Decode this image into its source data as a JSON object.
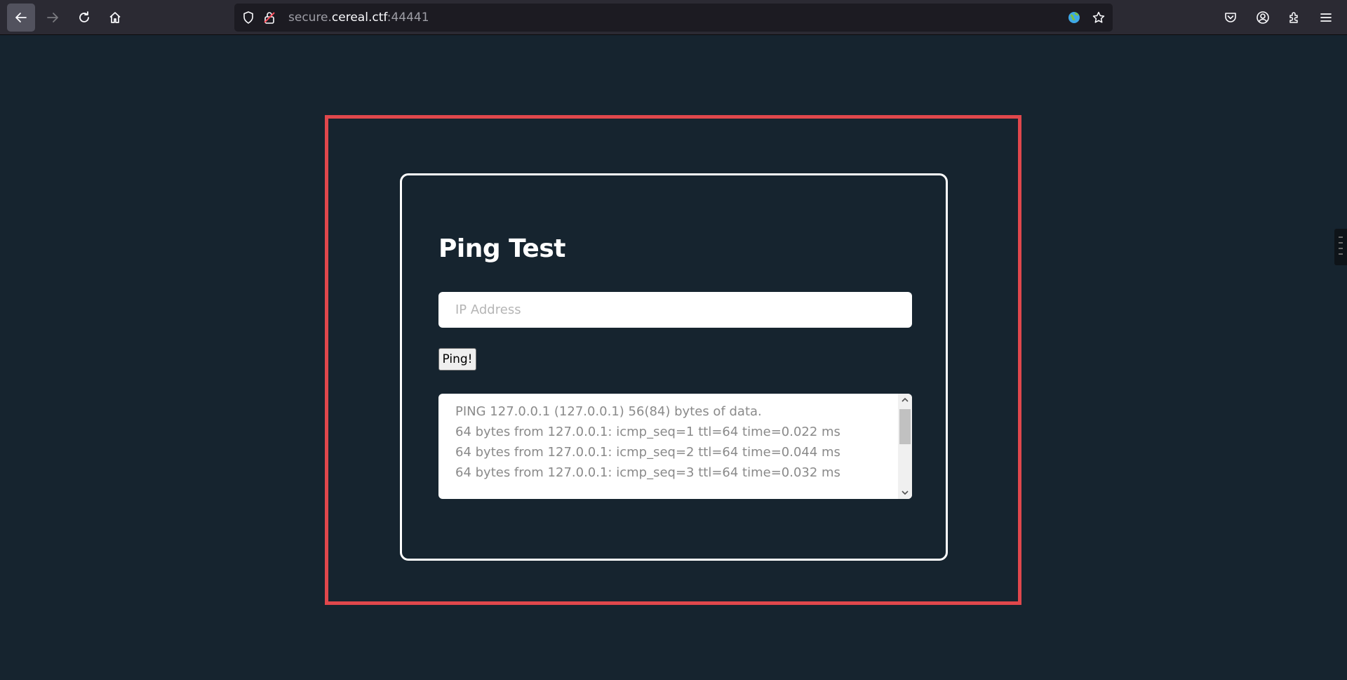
{
  "browser": {
    "url_prefix": "secure.",
    "url_host": "cereal.ctf",
    "url_suffix": ":44441",
    "toolbar_color": "#2b2a33",
    "icons": [
      "back-arrow-icon",
      "forward-arrow-icon",
      "reload-icon",
      "home-icon",
      "shield-icon",
      "insecure-lock-icon",
      "globe-icon",
      "star-icon",
      "pocket-icon",
      "account-icon",
      "extensions-icon",
      "menu-icon"
    ]
  },
  "page": {
    "background": "#16242f",
    "highlight_color": "#e0474c",
    "title": "Ping Test",
    "ip_placeholder": "IP Address",
    "ip_value": "",
    "ping_label": "Ping!",
    "output": [
      "PING 127.0.0.1 (127.0.0.1) 56(84) bytes of data.",
      "64 bytes from 127.0.0.1: icmp_seq=1 ttl=64 time=0.022 ms",
      "64 bytes from 127.0.0.1: icmp_seq=2 ttl=64 time=0.044 ms",
      "64 bytes from 127.0.0.1: icmp_seq=3 ttl=64 time=0.032 ms"
    ]
  }
}
